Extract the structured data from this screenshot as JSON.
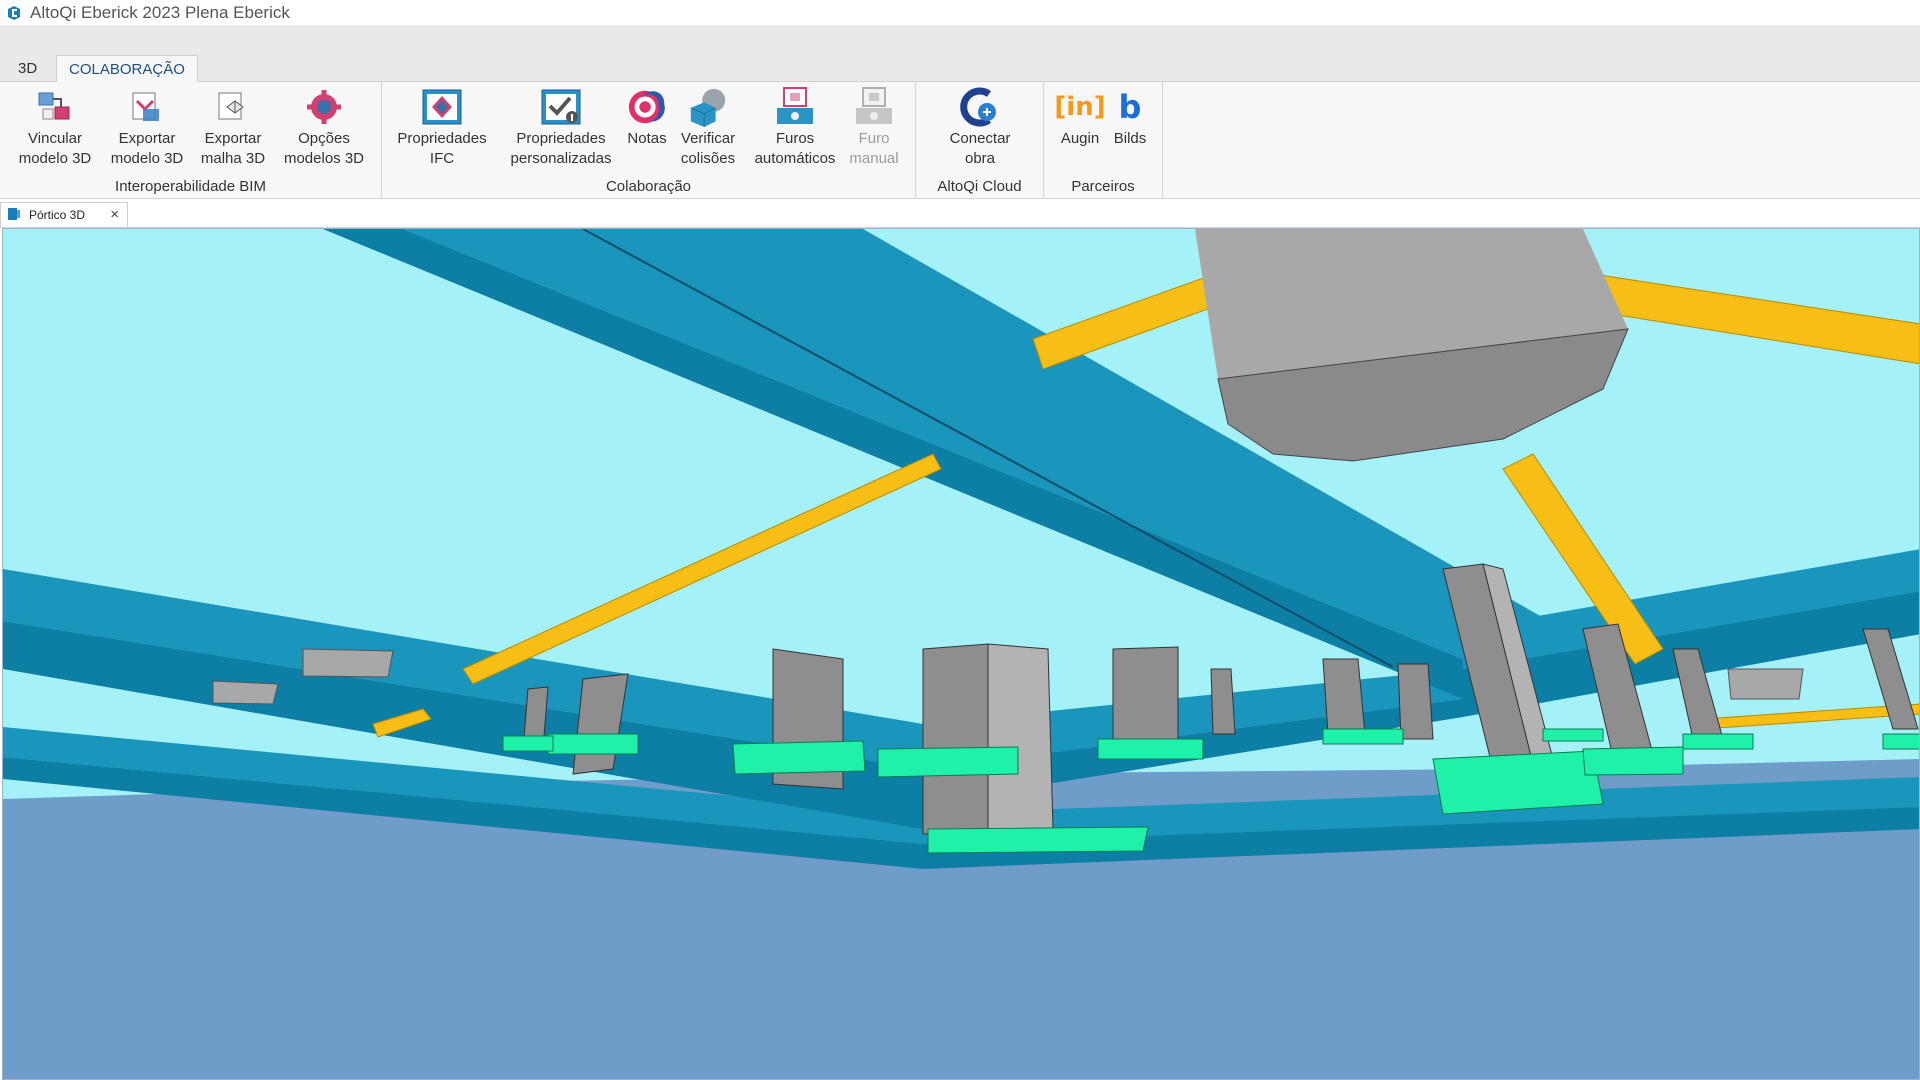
{
  "window": {
    "title": "AltoQi Eberick 2023 Plena Eberick"
  },
  "ribbon_tabs": [
    {
      "label": "3D",
      "active": false
    },
    {
      "label": "COLABORAÇÃO",
      "active": true
    }
  ],
  "groups": {
    "bim": {
      "label": "Interoperabilidade BIM",
      "buttons": [
        {
          "line1": "Vincular",
          "line2": "modelo 3D",
          "icon": "link-model-icon"
        },
        {
          "line1": "Exportar",
          "line2": "modelo 3D",
          "icon": "export-model-icon"
        },
        {
          "line1": "Exportar",
          "line2": "malha 3D",
          "icon": "export-mesh-icon"
        },
        {
          "line1": "Opções",
          "line2": "modelos 3D",
          "icon": "model-options-icon"
        }
      ]
    },
    "colab": {
      "label": "Colaboração",
      "buttons": [
        {
          "line1": "Propriedades",
          "line2": "IFC",
          "icon": "ifc-properties-icon"
        },
        {
          "line1": "Propriedades",
          "line2": "personalizadas",
          "icon": "custom-properties-icon"
        },
        {
          "line1": "Notas",
          "line2": "",
          "icon": "notes-icon"
        },
        {
          "line1": "Verificar",
          "line2": "colisões",
          "icon": "check-collisions-icon"
        },
        {
          "line1": "Furos",
          "line2": "automáticos",
          "icon": "auto-holes-icon"
        },
        {
          "line1": "Furo",
          "line2": "manual",
          "icon": "manual-hole-icon",
          "disabled": true
        }
      ]
    },
    "cloud": {
      "label": "AltoQi Cloud",
      "buttons": [
        {
          "line1": "Conectar",
          "line2": "obra",
          "icon": "connect-project-icon"
        }
      ]
    },
    "partners": {
      "label": "Parceiros",
      "buttons": [
        {
          "line1": "Augin",
          "line2": "",
          "icon": "augin-icon",
          "glyph": "[in]"
        },
        {
          "line1": "Bilds",
          "line2": "",
          "icon": "bilds-icon",
          "glyph": "b"
        }
      ]
    }
  },
  "document_tab": {
    "label": "Pórtico 3D",
    "close": "×"
  },
  "colors": {
    "sky": "#a4f2f7",
    "ground": "#6f9cc8",
    "beam": "#1a95bb",
    "beam_dark": "#0d7ea4",
    "column": "#8e8e8e",
    "footing": "#1ff2a8",
    "pipe": "#f7be16",
    "tank": "#a8a8a8"
  }
}
